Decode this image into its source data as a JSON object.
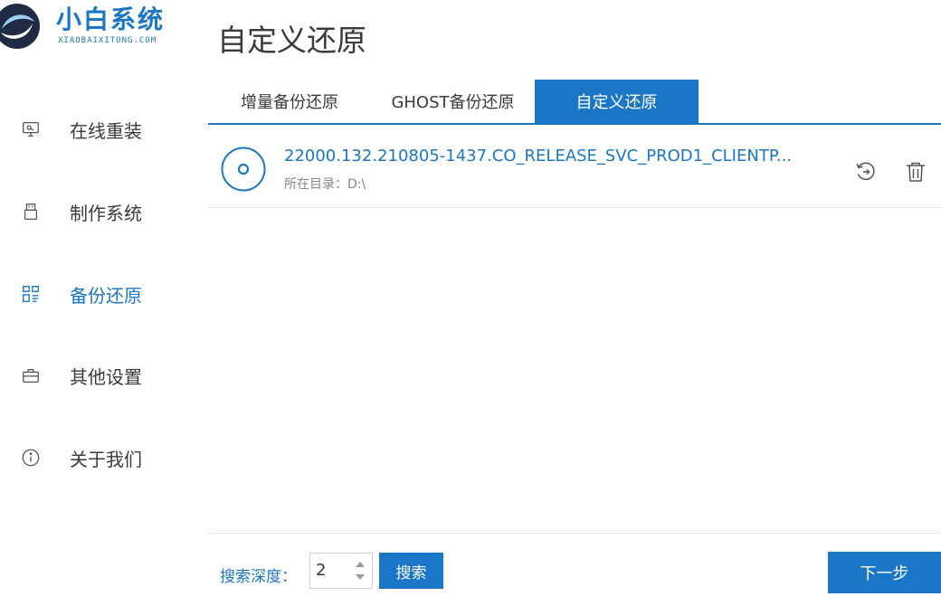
{
  "app": {
    "name": "小白系统",
    "site": "XIAOBAIXITONG.COM"
  },
  "page_title": "自定义还原",
  "colors": {
    "accent": "#1a76c7",
    "text": "#3b3b3b",
    "muted": "#888888"
  },
  "sidebar": {
    "items": [
      {
        "label": "在线重装",
        "icon": "monitor-icon",
        "active": false
      },
      {
        "label": "制作系统",
        "icon": "usb-drive-icon",
        "active": false
      },
      {
        "label": "备份还原",
        "icon": "backup-grid-icon",
        "active": true
      },
      {
        "label": "其他设置",
        "icon": "briefcase-icon",
        "active": false
      },
      {
        "label": "关于我们",
        "icon": "info-icon",
        "active": false
      }
    ]
  },
  "tabs": [
    {
      "label": "增量备份还原",
      "active": false
    },
    {
      "label": "GHOST备份还原",
      "active": false
    },
    {
      "label": "自定义还原",
      "active": true
    }
  ],
  "list": {
    "items": [
      {
        "name": "22000.132.210805-1437.CO_RELEASE_SVC_PROD1_CLIENTP...",
        "directory": "所在目录：D:\\",
        "icon": "disc-icon",
        "actions": [
          "restore-icon",
          "trash-icon"
        ]
      }
    ]
  },
  "footer": {
    "depth_label": "搜索深度：",
    "depth_value": "2",
    "search_label": "搜索",
    "next_label": "下一步"
  }
}
